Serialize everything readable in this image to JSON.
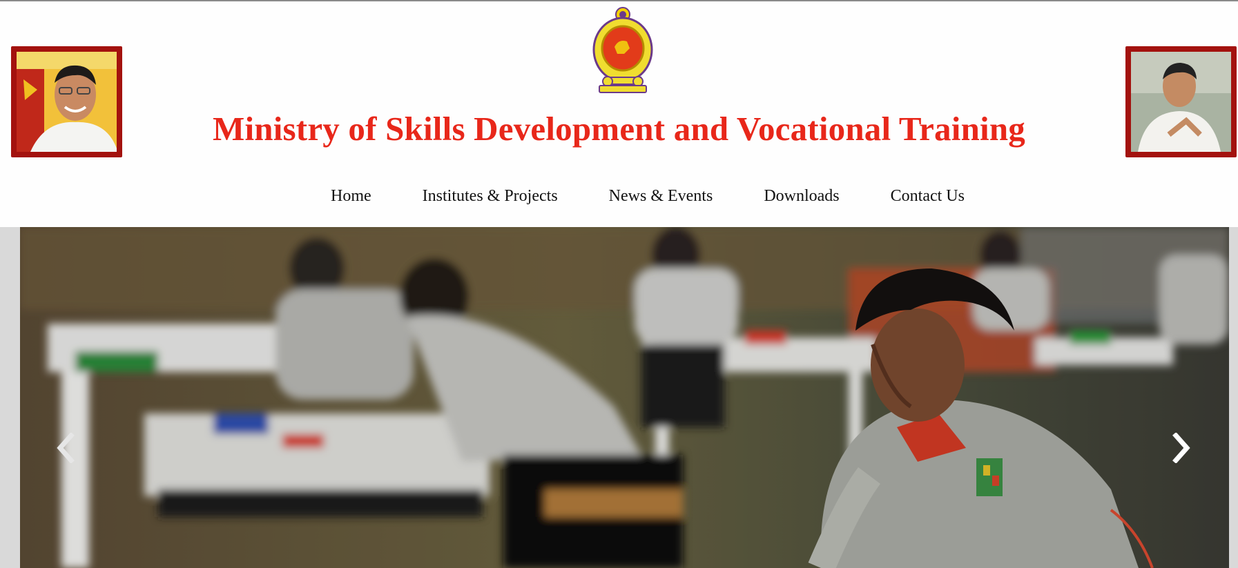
{
  "header": {
    "title": "Ministry of Skills Development and Vocational Training",
    "left_portrait": "president-portrait",
    "right_portrait": "minister-portrait",
    "emblem": "national-emblem"
  },
  "nav": {
    "items": [
      {
        "label": "Home"
      },
      {
        "label": "Institutes & Projects"
      },
      {
        "label": "News & Events"
      },
      {
        "label": "Downloads"
      },
      {
        "label": "Contact Us"
      }
    ]
  },
  "carousel": {
    "prev_icon": "chevron-left-icon",
    "next_icon": "chevron-right-icon"
  },
  "colors": {
    "title": "#e8271a",
    "portrait_border": "#a3120e",
    "nav_text": "#111111"
  }
}
